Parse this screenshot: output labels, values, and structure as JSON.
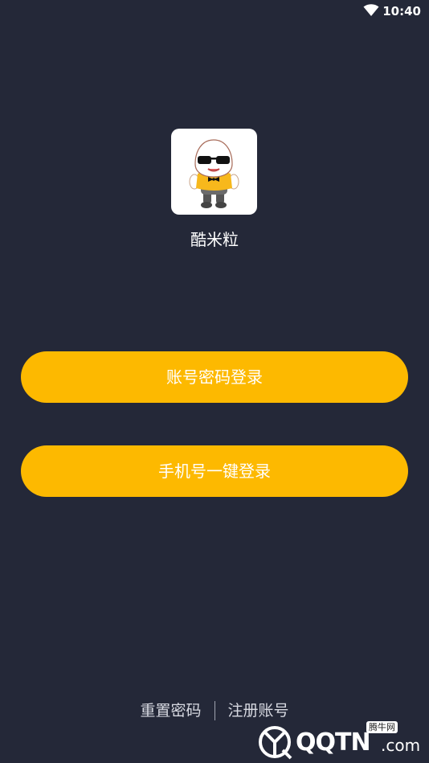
{
  "status_bar": {
    "time": "10:40",
    "wifi_icon": "wifi-icon"
  },
  "app": {
    "name": "酷米粒",
    "icon": "rice-mascot-icon"
  },
  "buttons": {
    "account_login": "账号密码登录",
    "phone_login": "手机号一键登录"
  },
  "footer": {
    "reset_password": "重置密码",
    "register": "注册账号"
  },
  "watermark": {
    "logo_text": "QQTN",
    "suffix": ".com",
    "badge": "腾牛网"
  },
  "colors": {
    "background": "#242838",
    "accent": "#fdb900",
    "button_text": "#ffffff"
  }
}
